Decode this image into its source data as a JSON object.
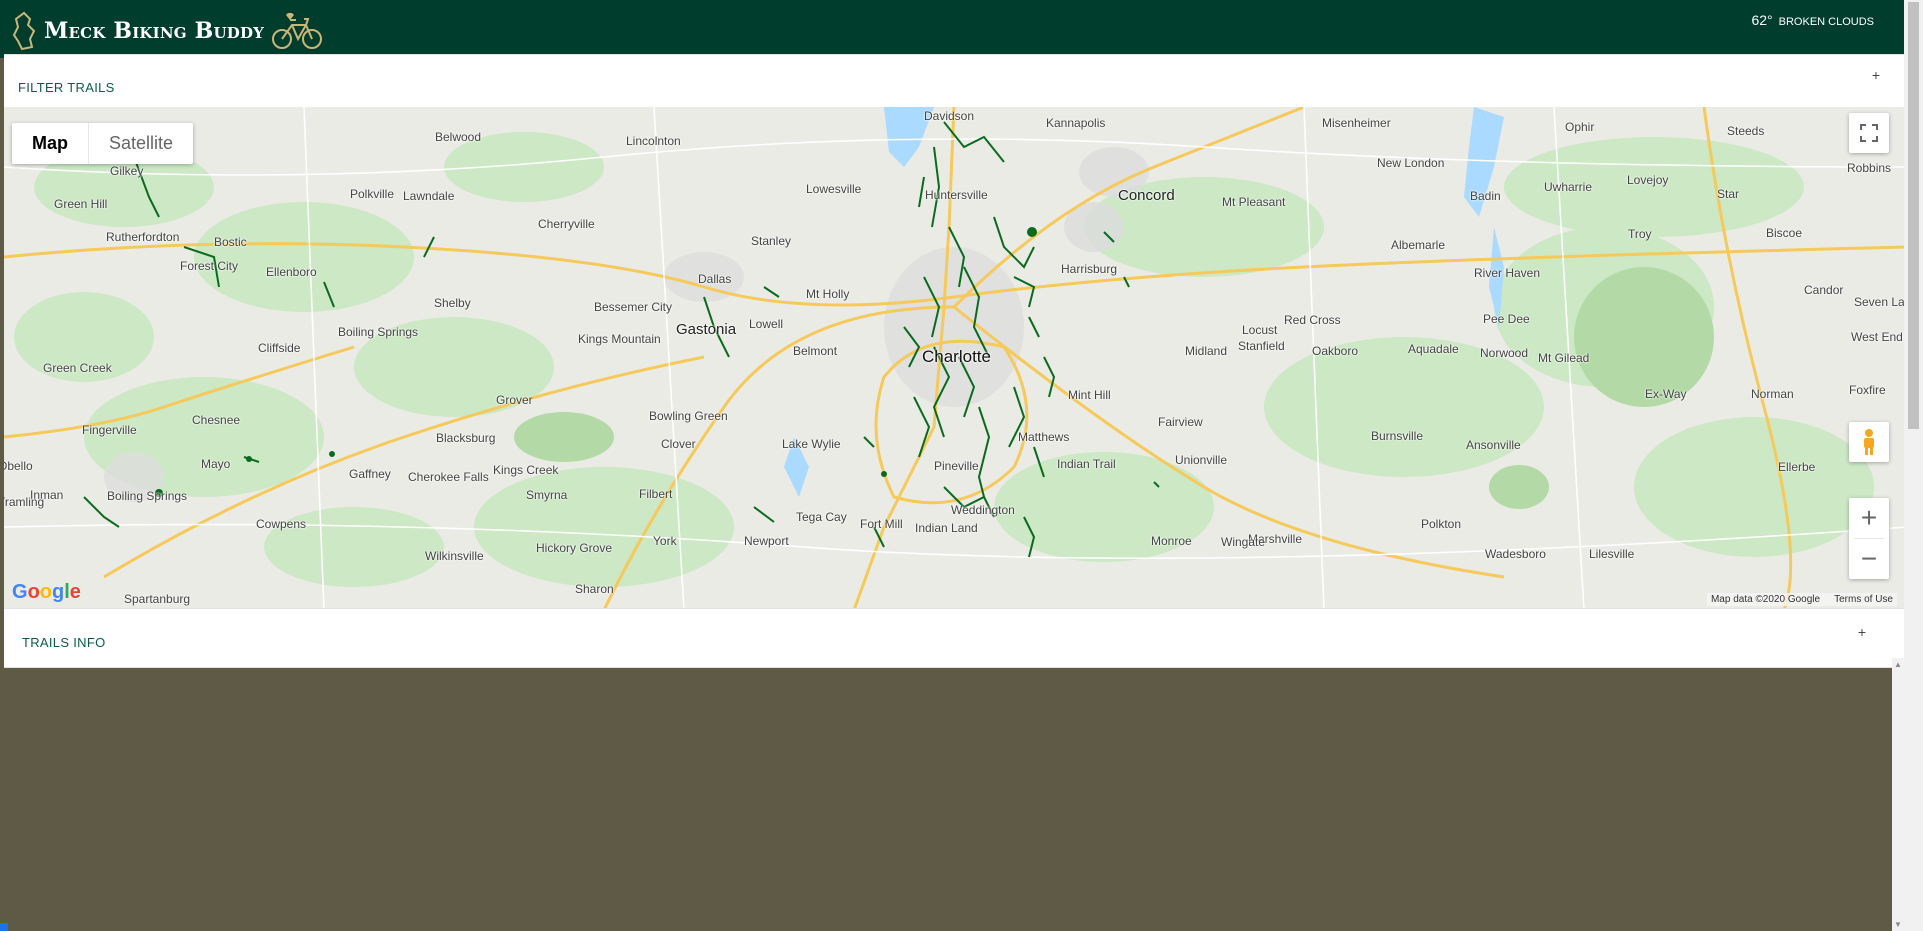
{
  "header": {
    "app_title": "Meck Biking Buddy",
    "weather_temp": "62°",
    "weather_condition": "BROKEN CLOUDS"
  },
  "filter_panel": {
    "label": "FILTER TRAILS",
    "toggle": "+"
  },
  "trails_panel": {
    "label": "TRAILS INFO",
    "toggle": "+"
  },
  "map": {
    "map_type_map": "Map",
    "map_type_satellite": "Satellite",
    "zoom_in": "+",
    "zoom_out": "−",
    "google": "Google",
    "attribution": "Map data ©2020 Google",
    "terms": "Terms of Use",
    "places": [
      "Davidson",
      "Kannapolis",
      "Misenheimer",
      "Ophir",
      "Steeds",
      "Belwood",
      "Lincolnton",
      "Gilkey",
      "Polkville",
      "Lawndale",
      "Huntersville",
      "Concord",
      "Mt Pleasant",
      "New London",
      "Badin",
      "Uwharrie",
      "Lovejoy",
      "Star",
      "Robbins",
      "Green Hill",
      "Cherryville",
      "Lowesville",
      "Rutherfordton",
      "Bostic",
      "Forest City",
      "Ellenboro",
      "Stanley",
      "Dallas",
      "Harrisburg",
      "Albemarle",
      "Troy",
      "Biscoe",
      "River Haven",
      "Candor",
      "Mt Holly",
      "Shelby",
      "Bessemer City",
      "Gastonia",
      "Lowell",
      "Locust",
      "Red Cross",
      "Pee Dee",
      "Seven Lake",
      "Boiling Springs",
      "Kings Mountain",
      "Belmont",
      "Charlotte",
      "Midland",
      "Stanfield",
      "Oakboro",
      "Aquadale",
      "Norwood",
      "Mt Gilead",
      "West End",
      "Cliffside",
      "Green Creek",
      "Grover",
      "Mint Hill",
      "Ex-Way",
      "Norman",
      "Foxfire",
      "Chesnee",
      "Fingerville",
      "Bowling Green",
      "Fairview",
      "Blacksburg",
      "Clover",
      "Lake Wylie",
      "Matthews",
      "Burnsville",
      "Ansonville",
      "Unionville",
      "Mayo",
      "Gaffney",
      "Cherokee Falls",
      "Kings Creek",
      "Pineville",
      "Indian Trail",
      "Ellerbe",
      "Inman",
      "Boiling Springs",
      "Smyrna",
      "Filbert",
      "Weddington",
      "Cowpens",
      "Tega Cay",
      "Fort Mill",
      "Indian Land",
      "Polkton",
      "Marshville",
      "Hickory Grove",
      "Newport",
      "York",
      "Monroe",
      "Wingate",
      "Wadesboro",
      "Lilesville",
      "Wilkinsville",
      "Sharon",
      "Spartanburg",
      "Obello",
      "Tramling"
    ]
  },
  "colors": {
    "header_bg": "#003d2c",
    "page_bg": "#5f5a45",
    "accent_text": "#0b5d4a",
    "trail_green": "#0a6b1f"
  }
}
